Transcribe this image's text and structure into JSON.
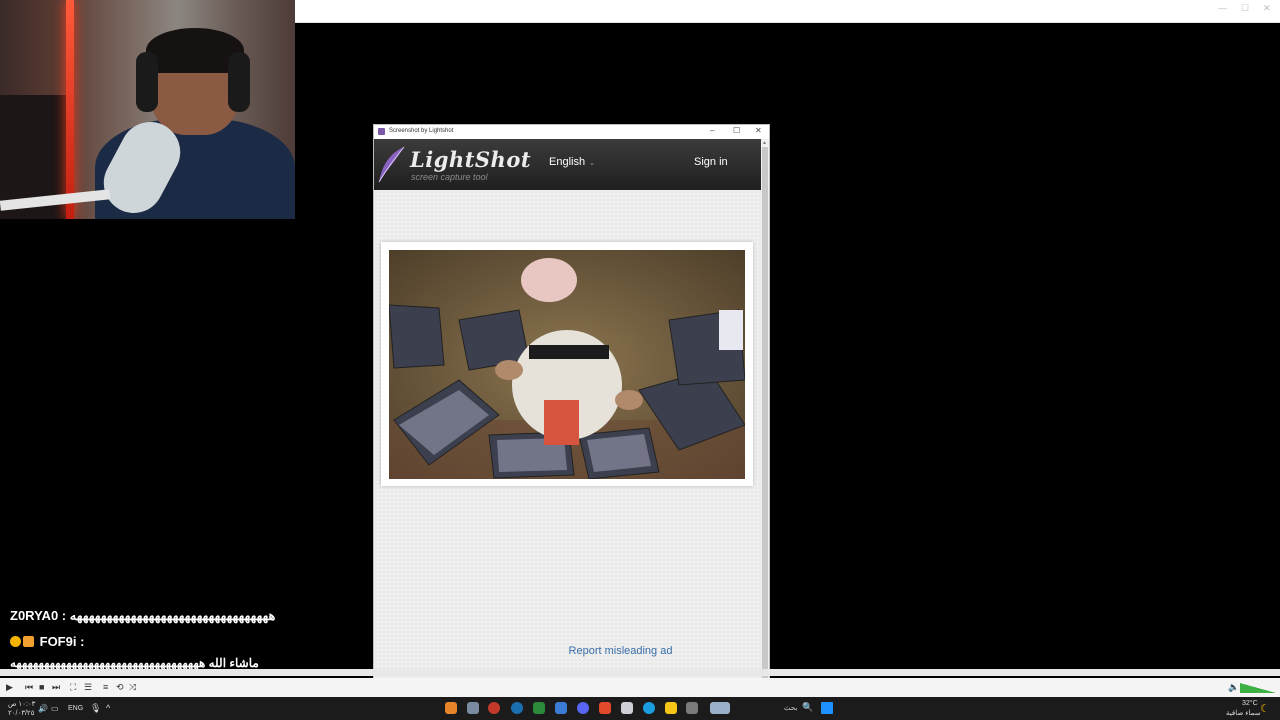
{
  "lightshot": {
    "window_title": "Screenshot by Lightshot",
    "logo_text": "LightShot",
    "tagline": "screen capture tool",
    "language": "English",
    "sign_in": "Sign in",
    "report_link": "Report misleading ad",
    "window_controls": [
      "–",
      "☐",
      "✕"
    ]
  },
  "chat": {
    "line1_user": "Z0RYA0 :",
    "line1_msg": "هههههههههههههههههههههههههههههههههه",
    "line2_user": "FOF9i :",
    "line3_msg": "ماشاء الله ههههههههههههههههههههههههههههههههههه"
  },
  "taskbar": {
    "language": "ENG",
    "search_label": "بحث",
    "weather_temp": "32°C",
    "weather_text": "سماء صافية",
    "clock_time": "١٠:٠٣ ص",
    "clock_date": "٢٠/٠٣/٢٥"
  },
  "colors": {
    "accent_link": "#3a6ea8",
    "header_dark": "#2a2a2a",
    "volume_green": "#3cb043"
  }
}
